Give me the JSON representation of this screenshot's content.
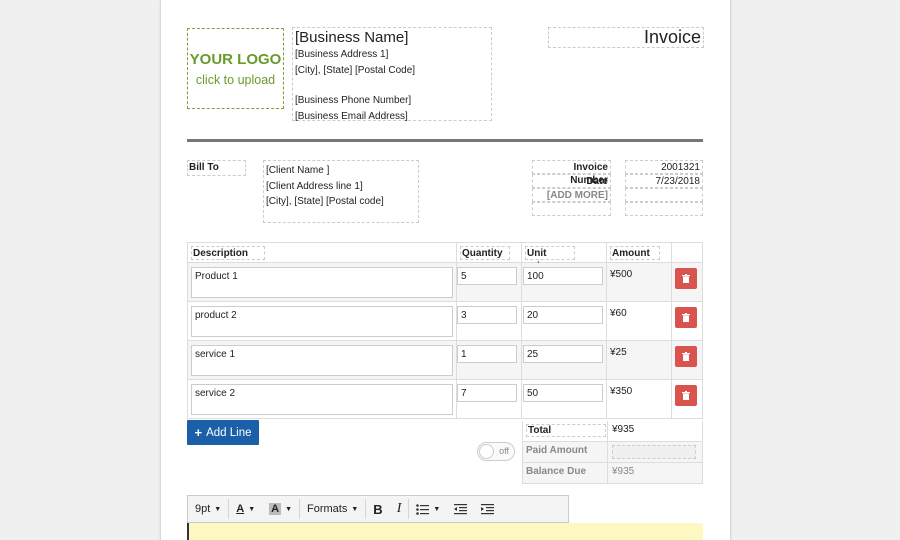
{
  "logo": {
    "main": "YOUR LOGO",
    "sub": "click to upload"
  },
  "business": {
    "name": "[Business Name]",
    "address1": "[Business Address 1]",
    "city_line": "[City], [State] [Postal Code]",
    "phone": "[Business Phone Number]",
    "email": "[Business Email Address]"
  },
  "invoice_title": "Invoice",
  "bill_to": {
    "label": "Bill To",
    "client_name": "[Client Name ]",
    "address1": "[Client Address line 1]",
    "city_line": "[City], [State] [Postal code]"
  },
  "meta": {
    "invoice_number_label": "Invoice Number",
    "invoice_number": "2001321",
    "date_label": "Date",
    "date": "7/23/2018",
    "add_more": "[ADD MORE]"
  },
  "table": {
    "headers": {
      "description": "Description",
      "quantity": "Quantity",
      "unit_price": "Unit price",
      "amount": "Amount"
    },
    "rows": [
      {
        "description": "Product 1",
        "quantity": "5",
        "unit_price": "100",
        "amount": "¥500"
      },
      {
        "description": "product 2",
        "quantity": "3",
        "unit_price": "20",
        "amount": "¥60"
      },
      {
        "description": "service 1",
        "quantity": "1",
        "unit_price": "25",
        "amount": "¥25"
      },
      {
        "description": "service 2",
        "quantity": "7",
        "unit_price": "50",
        "amount": "¥350"
      }
    ]
  },
  "add_line_label": "Add Line",
  "toggle_label": "off",
  "totals": {
    "total_label": "Total",
    "total_value": "¥935",
    "paid_label": "Paid Amount",
    "paid_value": "",
    "balance_label": "Balance Due",
    "balance_value": "¥935"
  },
  "toolbar": {
    "font_size": "9pt",
    "formats": "Formats"
  },
  "colors": {
    "accent": "#1a5fa8",
    "delete": "#d9534f",
    "logo": "#6a9a2a",
    "editor_bg": "#fdf7c2"
  }
}
